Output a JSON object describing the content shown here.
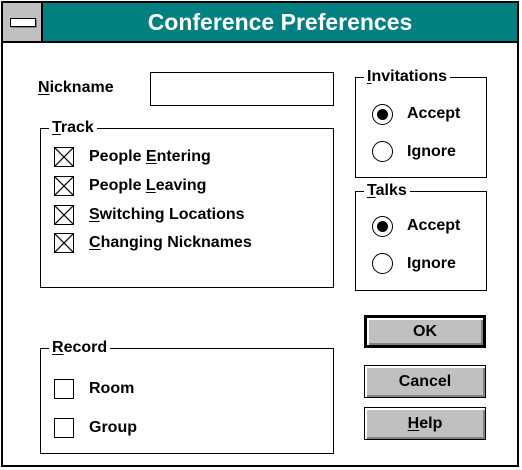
{
  "window": {
    "title": "Conference Preferences"
  },
  "nickname": {
    "label_prefix": "",
    "label_mnemonic": "N",
    "label_rest": "ickname",
    "value": ""
  },
  "track": {
    "title_mnemonic": "T",
    "title_rest": "rack",
    "items": [
      {
        "pre": "People ",
        "mn": "E",
        "post": "ntering",
        "checked": true
      },
      {
        "pre": "People ",
        "mn": "L",
        "post": "eaving",
        "checked": true
      },
      {
        "pre": "",
        "mn": "S",
        "post": "witching Locations",
        "checked": true
      },
      {
        "pre": "",
        "mn": "C",
        "post": "hanging Nicknames",
        "checked": true
      }
    ]
  },
  "invitations": {
    "title_mnemonic": "I",
    "title_rest": "nvitations",
    "accept": "Accept",
    "ignore": "Ignore",
    "selected": "Accept"
  },
  "talks": {
    "title_mnemonic": "T",
    "title_rest": "alks",
    "accept": "Accept",
    "ignore": "Ignore",
    "selected": "Accept"
  },
  "record": {
    "title_mnemonic": "R",
    "title_rest": "ecord",
    "room": {
      "label": "Room",
      "checked": false
    },
    "group": {
      "label": "Group",
      "checked": false
    }
  },
  "buttons": {
    "ok": "OK",
    "cancel": "Cancel",
    "help_mnemonic": "H",
    "help_rest": "elp"
  },
  "icons": {
    "system_menu": "system-menu-icon",
    "check": "x-check-icon",
    "radio": "radio-dot-icon"
  },
  "colors": {
    "titlebar": "#008080",
    "button_face": "#c0c0c0",
    "title_text": "#ffffff"
  }
}
